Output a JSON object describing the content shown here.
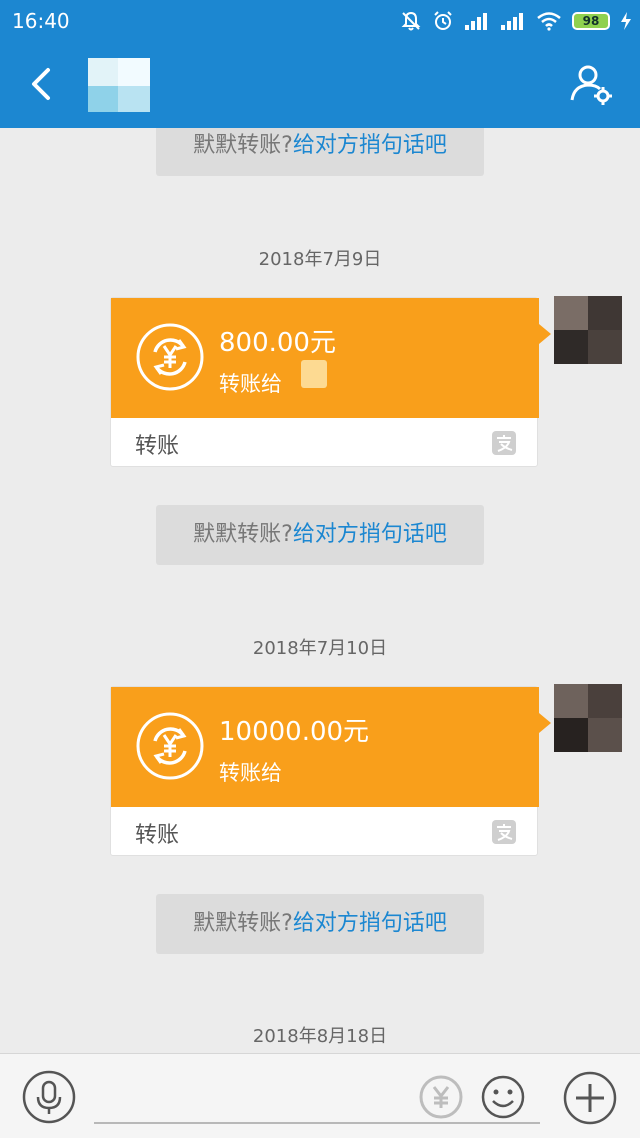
{
  "status_bar": {
    "time": "16:40",
    "battery": "98"
  },
  "chat": {
    "hint": {
      "prefix": "默默转账?",
      "link": "给对方捎句话吧"
    },
    "messages": [
      {
        "date": "2018年7月9日",
        "amount": "800.00元",
        "to_label": "转账给",
        "card_label": "转账"
      },
      {
        "date": "2018年7月10日",
        "amount": "10000.00元",
        "to_label": "转账给",
        "card_label": "转账"
      }
    ],
    "last_date": "2018年8月18日"
  },
  "colors": {
    "header": "#1c87d1",
    "card_orange": "#f99f1b",
    "link": "#1c87d1"
  },
  "icons": {
    "back": "chevron-left-icon",
    "contact_settings": "user-gear-icon",
    "voice": "microphone-icon",
    "transfer": "yen-transfer-icon",
    "emoji": "smiley-icon",
    "more": "plus-icon",
    "brand": "alipay-icon"
  }
}
